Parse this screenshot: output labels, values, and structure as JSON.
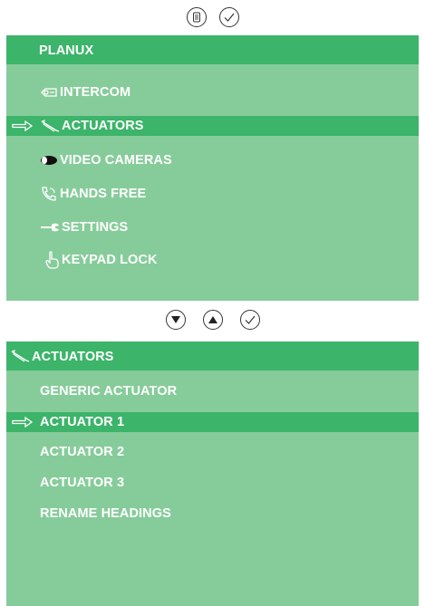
{
  "top_buttons": [
    {
      "name": "menu-button",
      "icon": "menu-icon"
    },
    {
      "name": "confirm-button",
      "icon": "check-icon"
    }
  ],
  "main_menu": {
    "title": "PLANUX",
    "selected_index": 1,
    "items": [
      {
        "label": "INTERCOM",
        "icon": "intercom-icon"
      },
      {
        "label": "ACTUATORS",
        "icon": "actuator-icon"
      },
      {
        "label": "VIDEO CAMERAS",
        "icon": "camera-icon"
      },
      {
        "label": "HANDS FREE",
        "icon": "handset-icon"
      },
      {
        "label": "SETTINGS",
        "icon": "wrench-icon"
      },
      {
        "label": "KEYPAD LOCK",
        "icon": "hand-pointer-icon"
      }
    ]
  },
  "nav_buttons": [
    {
      "name": "down-button",
      "icon": "triangle-down-icon"
    },
    {
      "name": "up-button",
      "icon": "triangle-up-icon"
    },
    {
      "name": "confirm-button",
      "icon": "check-icon"
    }
  ],
  "actuators_menu": {
    "title": "ACTUATORS",
    "title_icon": "actuator-icon",
    "selected_index": 1,
    "items": [
      {
        "label": "GENERIC ACTUATOR"
      },
      {
        "label": "ACTUATOR 1"
      },
      {
        "label": "ACTUATOR 2"
      },
      {
        "label": "ACTUATOR 3"
      },
      {
        "label": "RENAME HEADINGS"
      }
    ]
  },
  "colors": {
    "panel": "#86cc9a",
    "highlight": "#3cb46a",
    "text": "#ffffff"
  }
}
